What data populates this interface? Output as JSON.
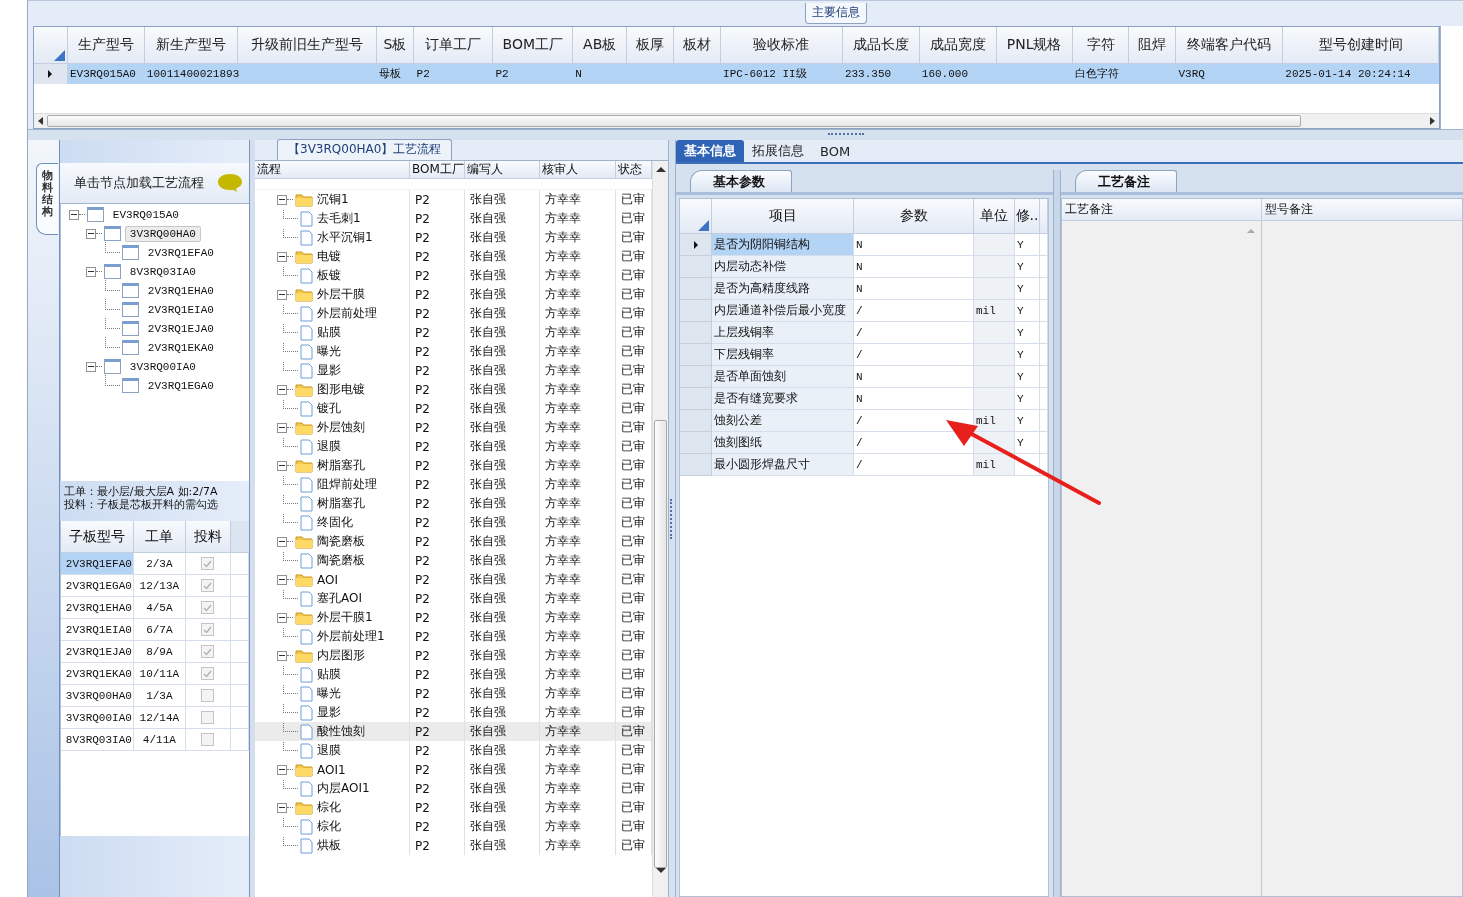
{
  "top_panel": {
    "title": "主要信息",
    "row_selected": true,
    "columns": [
      {
        "header": "生产型号",
        "value": "EV3RQ015A0"
      },
      {
        "header": "新生产型号",
        "value": "10011400021893"
      },
      {
        "header": "升级前旧生产型号"
      },
      {
        "header": "S板",
        "value": "母板"
      },
      {
        "header": "订单工厂",
        "value": "P2"
      },
      {
        "header": "BOM工厂",
        "value": "P2"
      },
      {
        "header": "AB板",
        "value": "N"
      },
      {
        "header": "板厚"
      },
      {
        "header": "板材"
      },
      {
        "header": "验收标准",
        "value": "IPC-6012 II级"
      },
      {
        "header": "成品长度",
        "value": "233.350"
      },
      {
        "header": "成品宽度",
        "value": "160.000"
      },
      {
        "header": "PNL规格"
      },
      {
        "header": "字符",
        "value": "白色字符"
      },
      {
        "header": "阻焊"
      },
      {
        "header": "终端客户代码",
        "value": "V3RQ"
      },
      {
        "header": "型号创建时间",
        "value": "2025-01-14 20:24:14"
      }
    ]
  },
  "structure_panel": {
    "side_tab": "物料结构",
    "hint": "单击节点加载工艺流程",
    "tree": [
      {
        "label": "EV3RQ015A0",
        "expanded": true,
        "selected": false,
        "children": [
          {
            "label": "3V3RQ00HA0",
            "expanded": true,
            "selected": true,
            "children": [
              {
                "label": "2V3RQ1EFA0",
                "selected": false
              }
            ]
          },
          {
            "label": "8V3RQ03IA0",
            "expanded": true,
            "selected": false,
            "children": [
              {
                "label": "2V3RQ1EHA0",
                "selected": false
              },
              {
                "label": "2V3RQ1EIA0",
                "selected": false
              },
              {
                "label": "2V3RQ1EJA0",
                "selected": false
              },
              {
                "label": "2V3RQ1EKA0",
                "selected": false
              }
            ]
          },
          {
            "label": "3V3RQ00IA0",
            "expanded": true,
            "selected": false,
            "children": [
              {
                "label": "2V3RQ1EGA0",
                "selected": false
              }
            ]
          }
        ]
      }
    ],
    "note": [
      "工单：最小层/最大层A 如:2/7A",
      "投料：子板是芯板开料的需勾选"
    ],
    "columns": [
      "子板型号",
      "工单",
      "投料"
    ],
    "rows": [
      {
        "model": "2V3RQ1EFA0",
        "order": "2/3A",
        "feed": true,
        "selected": true
      },
      {
        "model": "2V3RQ1EGA0",
        "order": "12/13A",
        "feed": true,
        "selected": false
      },
      {
        "model": "2V3RQ1EHA0",
        "order": "4/5A",
        "feed": true,
        "selected": false
      },
      {
        "model": "2V3RQ1EIA0",
        "order": "6/7A",
        "feed": true,
        "selected": false
      },
      {
        "model": "2V3RQ1EJA0",
        "order": "8/9A",
        "feed": true,
        "selected": false
      },
      {
        "model": "2V3RQ1EKA0",
        "order": "10/11A",
        "feed": true,
        "selected": false
      },
      {
        "model": "3V3RQ00HA0",
        "order": "1/3A",
        "feed": false,
        "selected": false
      },
      {
        "model": "3V3RQ00IA0",
        "order": "12/14A",
        "feed": false,
        "selected": false
      },
      {
        "model": "8V3RQ03IA0",
        "order": "4/11A",
        "feed": false,
        "selected": false
      }
    ]
  },
  "flow_panel": {
    "title": "【3V3RQ00HA0】工艺流程",
    "columns": [
      "流程",
      "BOM工厂",
      "编写人",
      "核审人",
      "状态"
    ],
    "rows": [
      {
        "name": "沉铜1",
        "bom": "P2",
        "author": "张自强",
        "reviewer": "方幸幸",
        "status": "已审",
        "selected": false,
        "expanded": true,
        "children": [
          {
            "name": "去毛刺1",
            "bom": "P2",
            "author": "张自强",
            "reviewer": "方幸幸",
            "status": "已审",
            "selected": false
          },
          {
            "name": "水平沉铜1",
            "bom": "P2",
            "author": "张自强",
            "reviewer": "方幸幸",
            "status": "已审",
            "selected": false
          }
        ]
      },
      {
        "name": "电镀",
        "bom": "P2",
        "author": "张自强",
        "reviewer": "方幸幸",
        "status": "已审",
        "selected": false,
        "expanded": true,
        "children": [
          {
            "name": "板镀",
            "bom": "P2",
            "author": "张自强",
            "reviewer": "方幸幸",
            "status": "已审",
            "selected": false
          }
        ]
      },
      {
        "name": "外层干膜",
        "bom": "P2",
        "author": "张自强",
        "reviewer": "方幸幸",
        "status": "已审",
        "selected": false,
        "expanded": true,
        "children": [
          {
            "name": "外层前处理",
            "bom": "P2",
            "author": "张自强",
            "reviewer": "方幸幸",
            "status": "已审",
            "selected": false
          },
          {
            "name": "贴膜",
            "bom": "P2",
            "author": "张自强",
            "reviewer": "方幸幸",
            "status": "已审",
            "selected": false
          },
          {
            "name": "曝光",
            "bom": "P2",
            "author": "张自强",
            "reviewer": "方幸幸",
            "status": "已审",
            "selected": false
          },
          {
            "name": "显影",
            "bom": "P2",
            "author": "张自强",
            "reviewer": "方幸幸",
            "status": "已审",
            "selected": false
          }
        ]
      },
      {
        "name": "图形电镀",
        "bom": "P2",
        "author": "张自强",
        "reviewer": "方幸幸",
        "status": "已审",
        "selected": false,
        "expanded": true,
        "children": [
          {
            "name": "镀孔",
            "bom": "P2",
            "author": "张自强",
            "reviewer": "方幸幸",
            "status": "已审",
            "selected": false
          }
        ]
      },
      {
        "name": "外层蚀刻",
        "bom": "P2",
        "author": "张自强",
        "reviewer": "方幸幸",
        "status": "已审",
        "selected": false,
        "expanded": true,
        "children": [
          {
            "name": "退膜",
            "bom": "P2",
            "author": "张自强",
            "reviewer": "方幸幸",
            "status": "已审",
            "selected": false
          }
        ]
      },
      {
        "name": "树脂塞孔",
        "bom": "P2",
        "author": "张自强",
        "reviewer": "方幸幸",
        "status": "已审",
        "selected": false,
        "expanded": true,
        "children": [
          {
            "name": "阻焊前处理",
            "bom": "P2",
            "author": "张自强",
            "reviewer": "方幸幸",
            "status": "已审",
            "selected": false
          },
          {
            "name": "树脂塞孔",
            "bom": "P2",
            "author": "张自强",
            "reviewer": "方幸幸",
            "status": "已审",
            "selected": false
          },
          {
            "name": "终固化",
            "bom": "P2",
            "author": "张自强",
            "reviewer": "方幸幸",
            "status": "已审",
            "selected": false
          }
        ]
      },
      {
        "name": "陶瓷磨板",
        "bom": "P2",
        "author": "张自强",
        "reviewer": "方幸幸",
        "status": "已审",
        "selected": false,
        "expanded": true,
        "children": [
          {
            "name": "陶瓷磨板",
            "bom": "P2",
            "author": "张自强",
            "reviewer": "方幸幸",
            "status": "已审",
            "selected": false
          }
        ]
      },
      {
        "name": "AOI",
        "bom": "P2",
        "author": "张自强",
        "reviewer": "方幸幸",
        "status": "已审",
        "selected": false,
        "expanded": true,
        "children": [
          {
            "name": "塞孔AOI",
            "bom": "P2",
            "author": "张自强",
            "reviewer": "方幸幸",
            "status": "已审",
            "selected": false
          }
        ]
      },
      {
        "name": "外层干膜1",
        "bom": "P2",
        "author": "张自强",
        "reviewer": "方幸幸",
        "status": "已审",
        "selected": false,
        "expanded": true,
        "children": [
          {
            "name": "外层前处理1",
            "bom": "P2",
            "author": "张自强",
            "reviewer": "方幸幸",
            "status": "已审",
            "selected": false
          }
        ]
      },
      {
        "name": "内层图形",
        "bom": "P2",
        "author": "张自强",
        "reviewer": "方幸幸",
        "status": "已审",
        "selected": false,
        "expanded": true,
        "children": [
          {
            "name": "贴膜",
            "bom": "P2",
            "author": "张自强",
            "reviewer": "方幸幸",
            "status": "已审",
            "selected": false
          },
          {
            "name": "曝光",
            "bom": "P2",
            "author": "张自强",
            "reviewer": "方幸幸",
            "status": "已审",
            "selected": false
          },
          {
            "name": "显影",
            "bom": "P2",
            "author": "张自强",
            "reviewer": "方幸幸",
            "status": "已审",
            "selected": false
          },
          {
            "name": "酸性蚀刻",
            "bom": "P2",
            "author": "张自强",
            "reviewer": "方幸幸",
            "status": "已审",
            "selected": true
          },
          {
            "name": "退膜",
            "bom": "P2",
            "author": "张自强",
            "reviewer": "方幸幸",
            "status": "已审",
            "selected": false
          }
        ]
      },
      {
        "name": "AOI1",
        "bom": "P2",
        "author": "张自强",
        "reviewer": "方幸幸",
        "status": "已审",
        "selected": false,
        "expanded": true,
        "children": [
          {
            "name": "内层AOI1",
            "bom": "P2",
            "author": "张自强",
            "reviewer": "方幸幸",
            "status": "已审",
            "selected": false
          }
        ]
      },
      {
        "name": "棕化",
        "bom": "P2",
        "author": "张自强",
        "reviewer": "方幸幸",
        "status": "已审",
        "selected": false,
        "expanded": true,
        "children": [
          {
            "name": "棕化",
            "bom": "P2",
            "author": "张自强",
            "reviewer": "方幸幸",
            "status": "已审",
            "selected": false
          },
          {
            "name": "烘板",
            "bom": "P2",
            "author": "张自强",
            "reviewer": "方幸幸",
            "status": "已审",
            "selected": false
          }
        ]
      }
    ]
  },
  "detail_panel": {
    "tabs": [
      {
        "label": "基本信息",
        "selected": true
      },
      {
        "label": "拓展信息",
        "selected": false
      },
      {
        "label": "BOM",
        "selected": false
      }
    ],
    "params": {
      "title": "基本参数",
      "columns": [
        "项目",
        "参数",
        "单位",
        "修.."
      ],
      "rows": [
        {
          "item": "是否为阴阳铜结构",
          "value": "N",
          "editable": "Y",
          "selected": true
        },
        {
          "item": "内层动态补偿",
          "value": "N",
          "editable": "Y",
          "selected": false
        },
        {
          "item": "是否为高精度线路",
          "value": "N",
          "editable": "Y",
          "selected": false
        },
        {
          "item": "内层通道补偿后最小宽度",
          "value": "/",
          "unit": "mil",
          "editable": "Y",
          "selected": false
        },
        {
          "item": "上层残铜率",
          "value": "/",
          "editable": "Y",
          "selected": false
        },
        {
          "item": "下层残铜率",
          "value": "/",
          "editable": "Y",
          "selected": false
        },
        {
          "item": "是否单面蚀刻",
          "value": "N",
          "editable": "Y",
          "selected": false
        },
        {
          "item": "是否有缝宽要求",
          "value": "N",
          "editable": "Y",
          "selected": false
        },
        {
          "item": "蚀刻公差",
          "value": "/",
          "unit": "mil",
          "editable": "Y",
          "selected": false
        },
        {
          "item": "蚀刻图纸",
          "value": "/",
          "editable": "Y",
          "selected": false
        },
        {
          "item": "最小圆形焊盘尺寸",
          "value": "/",
          "unit": "mil",
          "selected": false
        }
      ]
    },
    "remarks": {
      "title": "工艺备注",
      "columns": [
        "工艺备注",
        "型号备注"
      ]
    }
  }
}
